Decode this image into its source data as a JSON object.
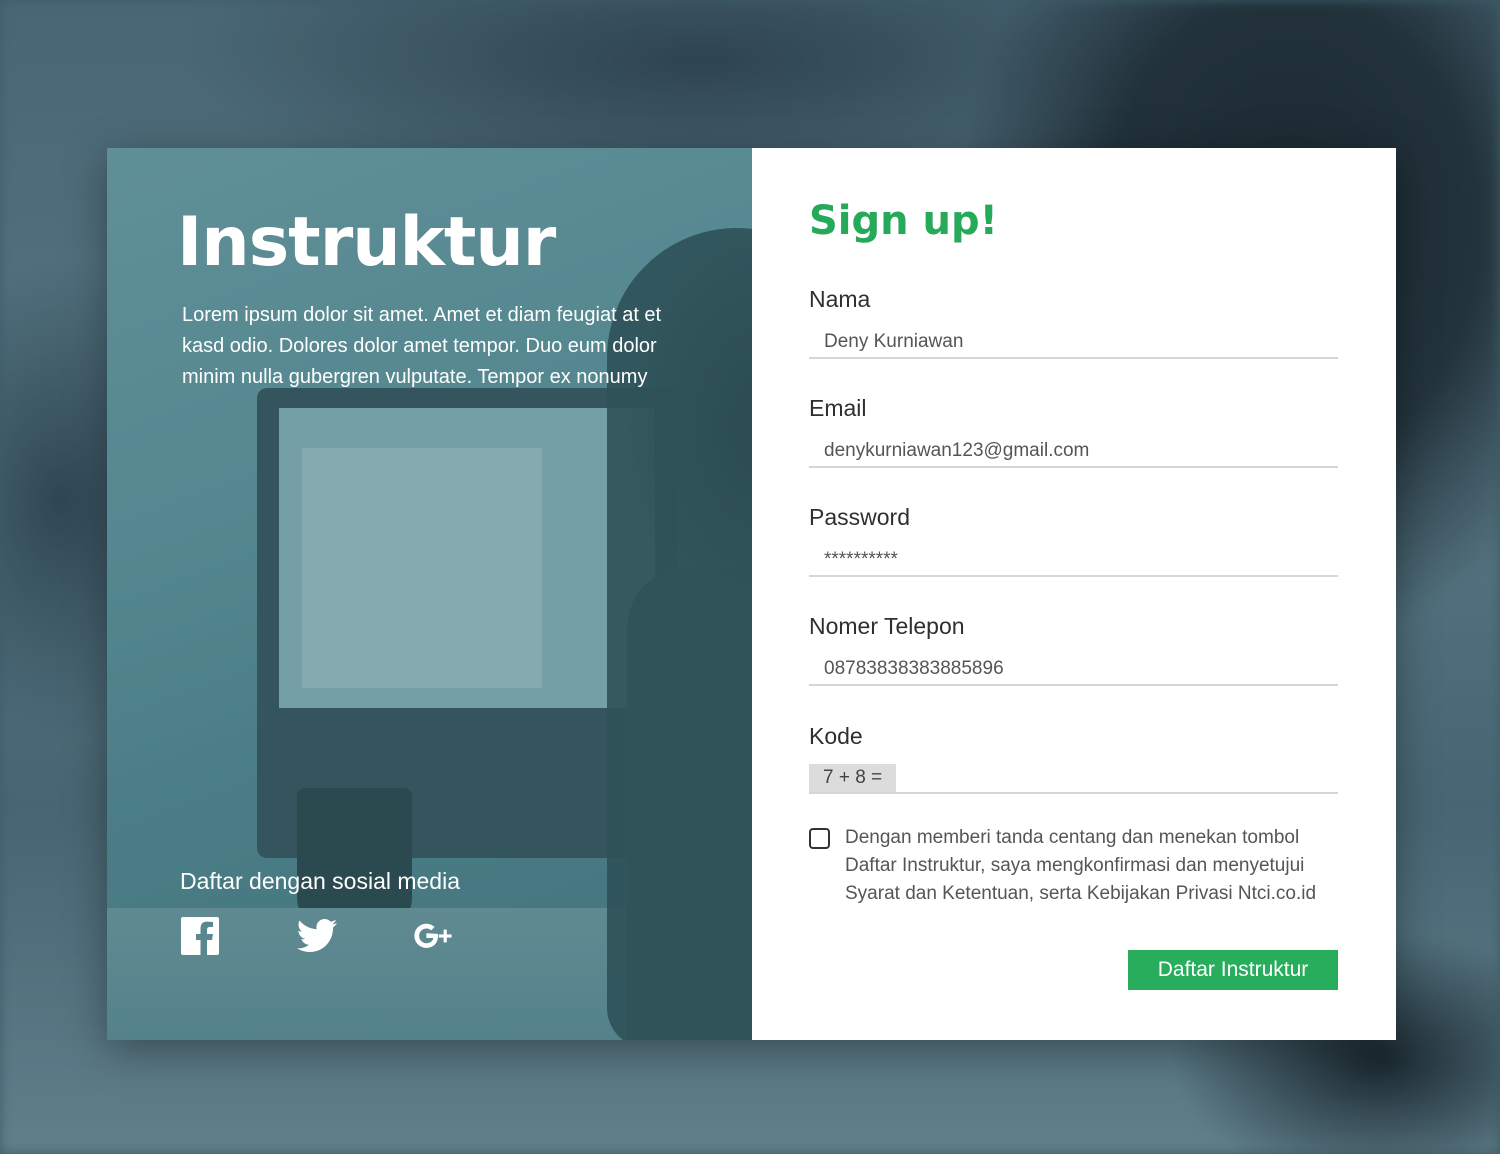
{
  "hero": {
    "title": "Instruktur",
    "description": "Lorem ipsum dolor sit amet. Amet et diam feugiat at et kasd odio. Dolores dolor amet tempor. Duo eum dolor minim nulla gubergren vulputate. Tempor ex nonumy",
    "social_label": "Daftar dengan sosial media",
    "social_icons": [
      "facebook-icon",
      "twitter-icon",
      "google-plus-icon"
    ]
  },
  "form": {
    "title": "Sign up!",
    "nama": {
      "label": "Nama",
      "value": "Deny Kurniawan"
    },
    "email": {
      "label": "Email",
      "value": "denykurniawan123@gmail.com"
    },
    "password": {
      "label": "Password",
      "value": "**********"
    },
    "telepon": {
      "label": "Nomer Telepon",
      "value": "08783838383885896"
    },
    "kode": {
      "label": "Kode",
      "question": "7 + 8 =",
      "value": ""
    },
    "agreement": "Dengan memberi tanda centang dan menekan tombol Daftar Instruktur, saya mengkonfirmasi dan menyetujui Syarat dan Ketentuan, serta Kebijakan Privasi Ntci.co.id",
    "submit_label": "Daftar Instruktur"
  },
  "colors": {
    "accent": "#27a95a",
    "button": "#27ad5c",
    "field_border": "#d6d6d6"
  }
}
